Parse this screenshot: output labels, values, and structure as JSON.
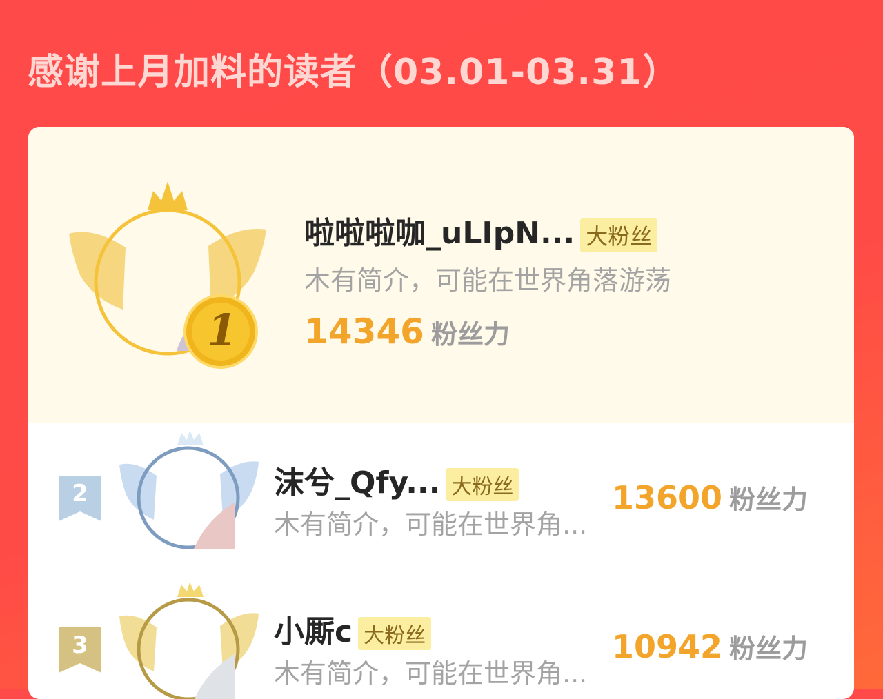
{
  "page": {
    "title": "感谢上月加料的读者（03.01-03.31）"
  },
  "unit_label": "粉丝力",
  "first": {
    "rank": "1",
    "name": "啦啦啦咖_uLIpN...",
    "badge": "大粉丝",
    "bio": "木有简介，可能在世界角落游荡",
    "score": "14346"
  },
  "rows": [
    {
      "rank": "2",
      "name": "沫兮_Qfy...",
      "badge": "大粉丝",
      "bio": "木有简介，可能在世界角...",
      "score": "13600"
    },
    {
      "rank": "3",
      "name": "小厮c",
      "badge": "大粉丝",
      "bio": "木有简介，可能在世界角...",
      "score": "10942"
    }
  ],
  "colors": {
    "gold": "#f5c33a",
    "silver": "#7e9cc0",
    "bronze": "#b79a45",
    "score": "#f2a52a"
  }
}
